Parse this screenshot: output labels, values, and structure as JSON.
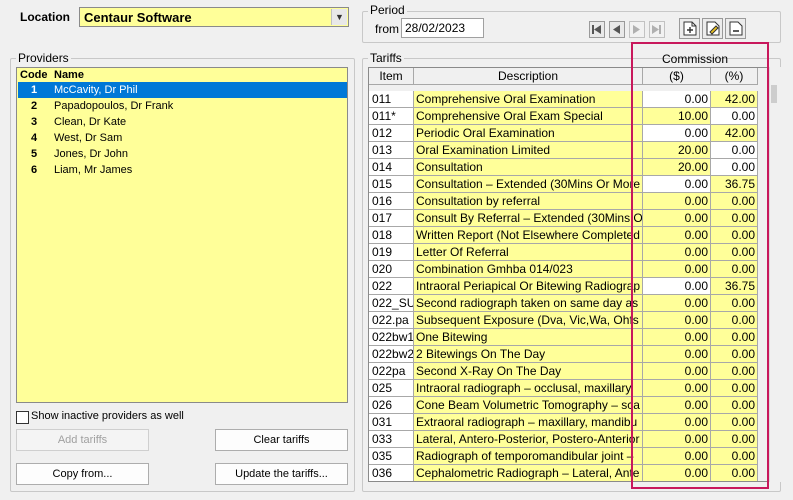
{
  "location": {
    "label": "Location",
    "value": "Centaur Software"
  },
  "period": {
    "title": "Period",
    "from_label": "from",
    "from_value": "28/02/2023"
  },
  "providers": {
    "title": "Providers",
    "columns": {
      "code": "Code",
      "name": "Name"
    },
    "items": [
      {
        "code": "1",
        "name": "McCavity, Dr Phil",
        "selected": true
      },
      {
        "code": "2",
        "name": "Papadopoulos, Dr Frank"
      },
      {
        "code": "3",
        "name": "Clean, Dr Kate"
      },
      {
        "code": "4",
        "name": "West, Dr Sam"
      },
      {
        "code": "5",
        "name": "Jones, Dr John"
      },
      {
        "code": "6",
        "name": "Liam, Mr James"
      }
    ],
    "show_inactive_label": "Show inactive providers as well",
    "add_tariffs": "Add tariffs",
    "clear_tariffs": "Clear tariffs",
    "copy_from": "Copy from...",
    "update_tariffs": "Update the tariffs..."
  },
  "tariffs": {
    "title": "Tariffs",
    "commission_label": "Commission",
    "headers": {
      "item": "Item",
      "description": "Description",
      "dollars": "($)",
      "percent": "(%)"
    },
    "rows": [
      {
        "item": "011",
        "desc": "Comprehensive Oral Examination",
        "dollars": "0.00",
        "percent": "42.00",
        "dw": true,
        "pw": false
      },
      {
        "item": "011*",
        "desc": "Comprehensive Oral Exam Special",
        "dollars": "10.00",
        "percent": "0.00",
        "dw": false,
        "pw": true
      },
      {
        "item": "012",
        "desc": "Periodic Oral Examination",
        "dollars": "0.00",
        "percent": "42.00",
        "dw": true,
        "pw": false
      },
      {
        "item": "013",
        "desc": "Oral Examination Limited",
        "dollars": "20.00",
        "percent": "0.00",
        "dw": false,
        "pw": true
      },
      {
        "item": "014",
        "desc": "Consultation",
        "dollars": "20.00",
        "percent": "0.00",
        "dw": false,
        "pw": true
      },
      {
        "item": "015",
        "desc": "Consultation – Extended (30Mins Or More",
        "dollars": "0.00",
        "percent": "36.75",
        "dw": true,
        "pw": false
      },
      {
        "item": "016",
        "desc": "Consultation by referral",
        "dollars": "0.00",
        "percent": "0.00",
        "dw": false,
        "pw": false
      },
      {
        "item": "017",
        "desc": "Consult By Referral – Extended  (30Mins O",
        "dollars": "0.00",
        "percent": "0.00",
        "dw": false,
        "pw": false
      },
      {
        "item": "018",
        "desc": "Written Report (Not Elsewhere Completed",
        "dollars": "0.00",
        "percent": "0.00",
        "dw": false,
        "pw": false
      },
      {
        "item": "019",
        "desc": "Letter Of Referral",
        "dollars": "0.00",
        "percent": "0.00",
        "dw": false,
        "pw": false
      },
      {
        "item": "020",
        "desc": "Combination Gmhba 014/023",
        "dollars": "0.00",
        "percent": "0.00",
        "dw": false,
        "pw": false
      },
      {
        "item": "022",
        "desc": "Intraoral Periapical Or Bitewing Radiograp",
        "dollars": "0.00",
        "percent": "36.75",
        "dw": true,
        "pw": false
      },
      {
        "item": "022_SU",
        "desc": "Second radiograph taken on same day as",
        "dollars": "0.00",
        "percent": "0.00",
        "dw": false,
        "pw": false
      },
      {
        "item": "022.pa",
        "desc": "Subsequent Exposure (Dva, Vic,Wa, Ohfs",
        "dollars": "0.00",
        "percent": "0.00",
        "dw": false,
        "pw": false
      },
      {
        "item": "022bw1",
        "desc": "One Bitewing",
        "dollars": "0.00",
        "percent": "0.00",
        "dw": false,
        "pw": false
      },
      {
        "item": "022bw2",
        "desc": "2 Bitewings On The Day",
        "dollars": "0.00",
        "percent": "0.00",
        "dw": false,
        "pw": false
      },
      {
        "item": "022pa",
        "desc": "Second X-Ray On The Day",
        "dollars": "0.00",
        "percent": "0.00",
        "dw": false,
        "pw": false
      },
      {
        "item": "025",
        "desc": "Intraoral radiograph – occlusal, maxillary,",
        "dollars": "0.00",
        "percent": "0.00",
        "dw": false,
        "pw": false
      },
      {
        "item": "026",
        "desc": "Cone Beam Volumetric Tomography – sca",
        "dollars": "0.00",
        "percent": "0.00",
        "dw": false,
        "pw": false
      },
      {
        "item": "031",
        "desc": " Extraoral radiograph – maxillary, mandibu",
        "dollars": "0.00",
        "percent": "0.00",
        "dw": false,
        "pw": false
      },
      {
        "item": "033",
        "desc": "Lateral, Antero-Posterior, Postero-Anterior",
        "dollars": "0.00",
        "percent": "0.00",
        "dw": false,
        "pw": false
      },
      {
        "item": "035",
        "desc": "Radiograph of temporomandibular joint –",
        "dollars": "0.00",
        "percent": "0.00",
        "dw": false,
        "pw": false
      },
      {
        "item": "036",
        "desc": "Cephalometric Radiograph – Lateral, Ante",
        "dollars": "0.00",
        "percent": "0.00",
        "dw": false,
        "pw": false
      }
    ]
  },
  "icons": {
    "nav": [
      "first-record-icon",
      "previous-record-icon",
      "next-record-icon",
      "last-record-icon"
    ],
    "tools": [
      "new-document-icon",
      "edit-document-icon",
      "delete-document-icon"
    ]
  },
  "colors": {
    "field_yellow": "#ffff99",
    "selection_blue": "#0078d7",
    "highlight_border": "#c8185c"
  }
}
